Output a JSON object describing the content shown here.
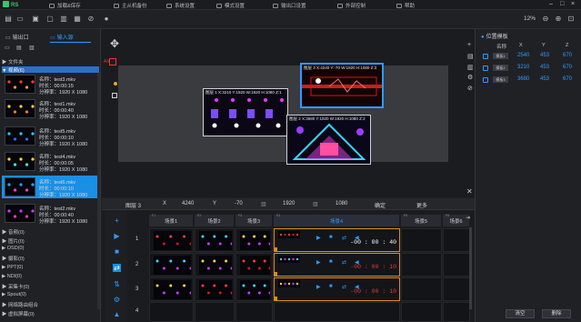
{
  "app": {
    "logo": "RS"
  },
  "menu": [
    {
      "label": "加载&保存"
    },
    {
      "label": "主从机备份"
    },
    {
      "label": "系统设置"
    },
    {
      "label": "模式设置"
    },
    {
      "label": "输出口设置"
    },
    {
      "label": "外部控制"
    },
    {
      "label": "帮助"
    }
  ],
  "toolbar": {
    "zoom": "12%"
  },
  "left": {
    "tab_out": "输出口",
    "tab_in": "输入源",
    "sections_top": [
      {
        "label": "▶ 文件夹"
      },
      {
        "label": "▼ 视频(6)"
      }
    ],
    "clips": [
      {
        "name": "名称：test3.mkv",
        "dur": "时长：00:00:15",
        "res": "分辨率：1920 X 1080"
      },
      {
        "name": "名称：test1.mkv",
        "dur": "时长：00:00:40",
        "res": "分辨率：1920 X 1080"
      },
      {
        "name": "名称：test5.mkv",
        "dur": "时长：00:00:10",
        "res": "分辨率：1920 X 1080"
      },
      {
        "name": "名称：test4.mkv",
        "dur": "时长：00:00:05",
        "res": "分辨率：1920 X 1080"
      },
      {
        "name": "名称：test6.mkv",
        "dur": "时长：00:00:10",
        "res": "分辨率：1920 X 1080"
      },
      {
        "name": "名称：test2.mkv",
        "dur": "时长：00:00:40",
        "res": "分辨率：1920 X 1080"
      }
    ],
    "sections_bottom": [
      {
        "label": "▶ 音频(0)"
      },
      {
        "label": "▶ 图片(0)"
      },
      {
        "label": "▶ OSD(0)"
      },
      {
        "label": "▶ 摄影(0)"
      },
      {
        "label": "▶ PPT(0)"
      },
      {
        "label": "▶ NDI(0)"
      },
      {
        "label": "▶ 采集卡(0)"
      },
      {
        "label": "▶ Spout(0)"
      },
      {
        "label": "▶ 网络路由组合"
      },
      {
        "label": "▶ 虚拟屏幕(0)"
      }
    ]
  },
  "canvas": {
    "layers": [
      {
        "label": "图层 1  X:3210  Y:1920  W:1920  H:1080  Z:1"
      },
      {
        "label": "图层 3  X:4240  Y:-70  W:1920  H:1080  Z:3"
      },
      {
        "label": "图层 2  X:3680  Y:1920  W:1920  H:1080  Z:2"
      }
    ]
  },
  "propbar": {
    "name": "图层 3",
    "x_label": "X",
    "x": "4240",
    "y_label": "Y",
    "y": "-70",
    "w": "1920",
    "h": "1080",
    "btn1": "确定",
    "btn2": "更多"
  },
  "timeline": {
    "scenes": [
      {
        "no": "F1",
        "label": "场景1"
      },
      {
        "no": "F2",
        "label": "场景2"
      },
      {
        "no": "F3",
        "label": "场景3"
      },
      {
        "no": "F4",
        "label": "场景4"
      },
      {
        "no": "F5",
        "label": "场景5"
      },
      {
        "no": "F6",
        "label": "场景6"
      }
    ],
    "rows": [
      "1",
      "2",
      "3",
      "4"
    ],
    "timers": [
      {
        "text": "-00 : 00 : 40",
        "color": "#ffffff"
      },
      {
        "text": "-00 : 00 : 10",
        "color": "#e53935"
      },
      {
        "text": "-00 : 00 : 10",
        "color": "#e53935"
      }
    ]
  },
  "right": {
    "title": "位置模板",
    "cols": {
      "name": "名称",
      "x": "X",
      "y": "Y",
      "z": "Z"
    },
    "rows": [
      {
        "name": "模板1",
        "x": "2540",
        "y": "453",
        "z": "670"
      },
      {
        "name": "模板2",
        "x": "3210",
        "y": "453",
        "z": "670"
      },
      {
        "name": "模板3",
        "x": "3680",
        "y": "453",
        "z": "670"
      }
    ],
    "btn_clear": "清空",
    "btn_delete": "删除"
  }
}
